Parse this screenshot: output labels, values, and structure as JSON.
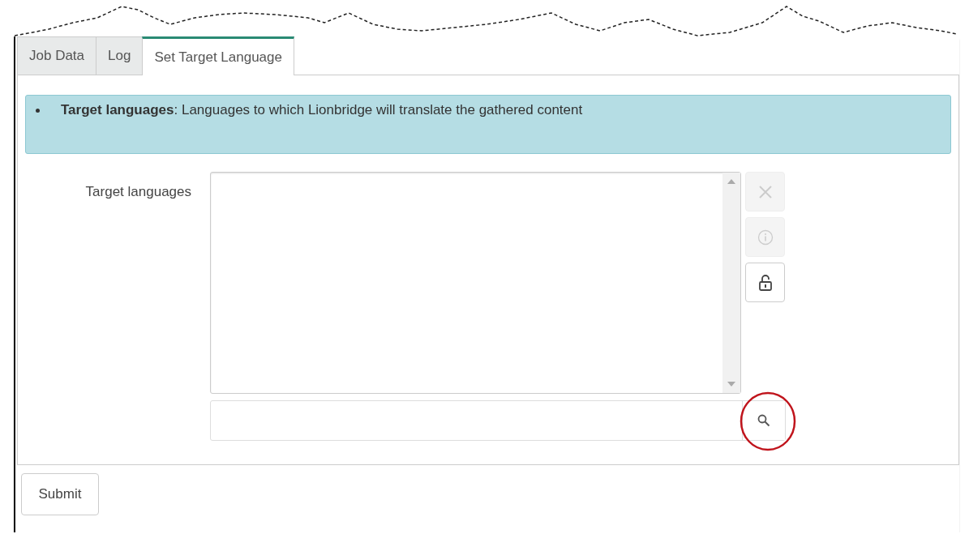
{
  "tabs": [
    {
      "label": "Job Data",
      "selected": false
    },
    {
      "label": "Log",
      "selected": false
    },
    {
      "label": "Set Target Language",
      "selected": true
    }
  ],
  "info": {
    "items": [
      "**Target languages**: Languages to which Lionbridge will translate the gathered content"
    ]
  },
  "field": {
    "label": "Target languages",
    "actions": [
      {
        "kind": "clear",
        "disabled": true
      },
      {
        "kind": "info",
        "disabled": true
      },
      {
        "kind": "unlock",
        "disabled": false
      }
    ],
    "search_highlighted": true
  },
  "submit": "Submit"
}
